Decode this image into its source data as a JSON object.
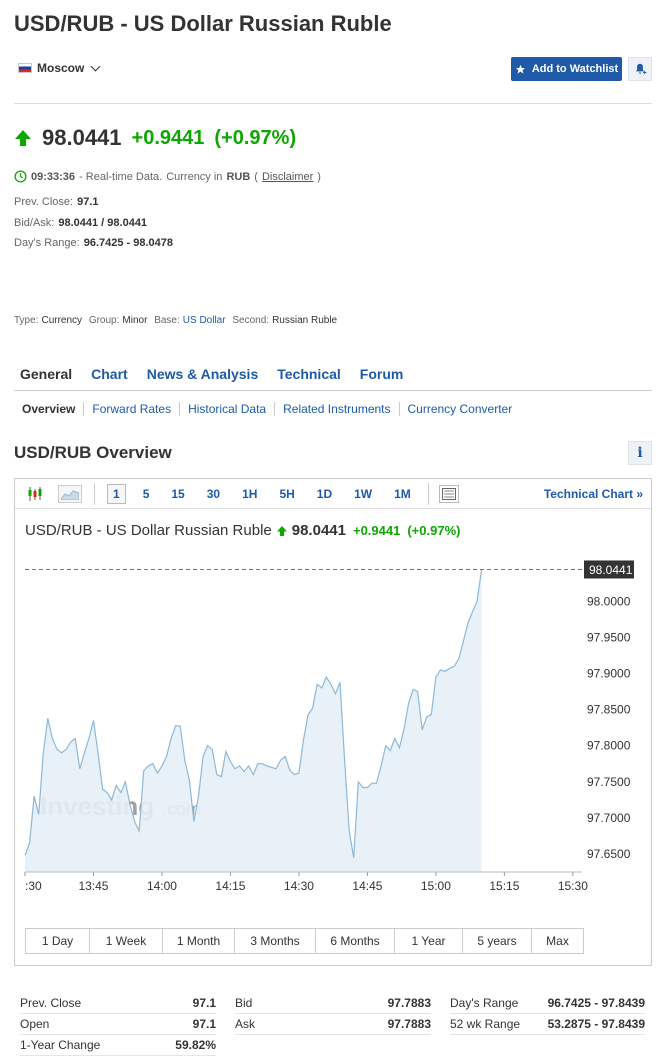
{
  "header": {
    "title": "USD/RUB - US Dollar Russian Ruble",
    "location": "Moscow",
    "watchlist_label": "Add to Watchlist"
  },
  "quote": {
    "last": "98.0441",
    "change": "+0.9441",
    "change_pct": "(+0.97%)",
    "time": "09:33:36",
    "realtime_text": "- Real-time Data.",
    "currency_text": "Currency in",
    "currency": "RUB",
    "disclaimer": "Disclaimer",
    "prev_close_label": "Prev. Close:",
    "prev_close": "97.1",
    "bidask_label": "Bid/Ask:",
    "bidask": "98.0441 / 98.0441",
    "range_label": "Day's Range:",
    "range": "96.7425 - 98.0478"
  },
  "meta": {
    "type_label": "Type:",
    "type": "Currency",
    "group_label": "Group:",
    "group": "Minor",
    "base_label": "Base:",
    "base": "US Dollar",
    "second_label": "Second:",
    "second": "Russian Ruble"
  },
  "tabs": [
    "General",
    "Chart",
    "News & Analysis",
    "Technical",
    "Forum"
  ],
  "subtabs": [
    "Overview",
    "Forward Rates",
    "Historical Data",
    "Related Instruments",
    "Currency Converter"
  ],
  "overview_title": "USD/RUB Overview",
  "toolbar": {
    "intervals": [
      "1",
      "5",
      "15",
      "30",
      "1H",
      "5H",
      "1D",
      "1W",
      "1M"
    ],
    "tech_chart": "Technical Chart »"
  },
  "chart_title": {
    "name": "USD/RUB - US Dollar Russian Ruble",
    "price": "98.0441",
    "change": "+0.9441",
    "pct": "(+0.97%)"
  },
  "watermark": "Investing.com",
  "chart_data": {
    "type": "area",
    "current_label": "98.0441",
    "ylim": [
      97.625,
      98.06
    ],
    "yticks": [
      "98.0000",
      "97.9500",
      "97.9000",
      "97.8500",
      "97.8000",
      "97.7500",
      "97.7000",
      "97.6500"
    ],
    "ytick_values": [
      98.0,
      97.95,
      97.9,
      97.85,
      97.8,
      97.75,
      97.7,
      97.65
    ],
    "xticks": [
      ":30",
      "13:45",
      "14:00",
      "14:15",
      "14:30",
      "14:45",
      "15:00",
      "15:15",
      "15:30"
    ],
    "xtick_minutes": [
      0,
      15,
      30,
      45,
      60,
      75,
      90,
      105,
      120
    ],
    "x_minutes": [
      0,
      1,
      2,
      3,
      4,
      5,
      6,
      7,
      8,
      9,
      10,
      11,
      12,
      13,
      14,
      15,
      16,
      17,
      18,
      19,
      20,
      21,
      22,
      23,
      24,
      25,
      26,
      27,
      28,
      29,
      30,
      31,
      32,
      33,
      34,
      35,
      36,
      37,
      38,
      39,
      40,
      41,
      42,
      43,
      44,
      45,
      46,
      47,
      48,
      49,
      50,
      51,
      52,
      53,
      54,
      55,
      56,
      57,
      58,
      59,
      60,
      61,
      62,
      63,
      64,
      65,
      66,
      67,
      68,
      69,
      70,
      71,
      72,
      73,
      74,
      75,
      76,
      77,
      78,
      79,
      80,
      81,
      82,
      83,
      84,
      85,
      86,
      87,
      88,
      89,
      90,
      91,
      92,
      93,
      94,
      95,
      96,
      97,
      98,
      99,
      100,
      101,
      102,
      103,
      104,
      105,
      106,
      107,
      108,
      109,
      110,
      111,
      112,
      113,
      114,
      115,
      116,
      117,
      118,
      119,
      120,
      121,
      122
    ],
    "values": [
      97.648,
      97.665,
      97.73,
      97.705,
      97.79,
      97.838,
      97.81,
      97.795,
      97.79,
      97.795,
      97.805,
      97.81,
      97.768,
      97.79,
      97.81,
      97.835,
      97.79,
      97.74,
      97.735,
      97.725,
      97.745,
      97.735,
      97.75,
      97.718,
      97.695,
      97.682,
      97.765,
      97.772,
      97.775,
      97.762,
      97.772,
      97.785,
      97.81,
      97.828,
      97.827,
      97.78,
      97.752,
      97.695,
      97.73,
      97.785,
      97.8,
      97.795,
      97.76,
      97.757,
      97.792,
      97.778,
      97.768,
      97.772,
      97.764,
      97.772,
      97.76,
      97.775,
      97.775,
      97.772,
      97.77,
      97.768,
      97.78,
      97.785,
      97.766,
      97.76,
      97.762,
      97.808,
      97.843,
      97.852,
      97.885,
      97.88,
      97.895,
      97.885,
      97.872,
      97.888,
      97.78,
      97.682,
      97.645,
      97.75,
      97.742,
      97.742,
      97.748,
      97.748,
      97.772,
      97.8,
      97.793,
      97.81,
      97.797,
      97.822,
      97.858,
      97.878,
      97.875,
      97.822,
      97.84,
      97.843,
      97.895,
      97.905,
      97.903,
      97.907,
      97.91,
      97.92,
      97.944,
      97.97,
      97.985,
      98.0,
      98.044
    ],
    "series_x_note": ""
  },
  "ranges": [
    "1 Day",
    "1 Week",
    "1 Month",
    "3 Months",
    "6 Months",
    "1 Year",
    "5 years",
    "Max"
  ],
  "stats": {
    "col1": [
      [
        "Prev. Close",
        "97.1"
      ],
      [
        "Open",
        "97.1"
      ],
      [
        "1-Year Change",
        "59.82%"
      ]
    ],
    "col2": [
      [
        "Bid",
        "97.7883"
      ],
      [
        "Ask",
        "97.7883"
      ]
    ],
    "col3": [
      [
        "Day's Range",
        "96.7425 - 97.8439"
      ],
      [
        "52 wk Range",
        "53.2875 - 97.8439"
      ]
    ]
  },
  "colors": {
    "up": "#0ea600",
    "link": "#1e5aa8",
    "area_line": "#8fb8d6",
    "area_fill": "#e6eff6"
  }
}
